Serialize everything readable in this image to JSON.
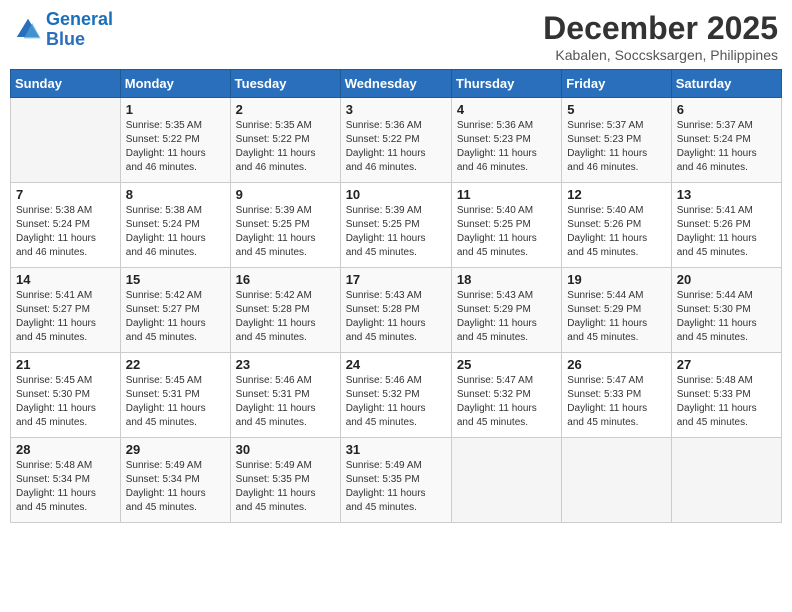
{
  "logo": {
    "line1": "General",
    "line2": "Blue"
  },
  "title": "December 2025",
  "subtitle": "Kabalen, Soccsksargen, Philippines",
  "weekdays": [
    "Sunday",
    "Monday",
    "Tuesday",
    "Wednesday",
    "Thursday",
    "Friday",
    "Saturday"
  ],
  "weeks": [
    [
      {
        "day": "",
        "info": ""
      },
      {
        "day": "1",
        "info": "Sunrise: 5:35 AM\nSunset: 5:22 PM\nDaylight: 11 hours\nand 46 minutes."
      },
      {
        "day": "2",
        "info": "Sunrise: 5:35 AM\nSunset: 5:22 PM\nDaylight: 11 hours\nand 46 minutes."
      },
      {
        "day": "3",
        "info": "Sunrise: 5:36 AM\nSunset: 5:22 PM\nDaylight: 11 hours\nand 46 minutes."
      },
      {
        "day": "4",
        "info": "Sunrise: 5:36 AM\nSunset: 5:23 PM\nDaylight: 11 hours\nand 46 minutes."
      },
      {
        "day": "5",
        "info": "Sunrise: 5:37 AM\nSunset: 5:23 PM\nDaylight: 11 hours\nand 46 minutes."
      },
      {
        "day": "6",
        "info": "Sunrise: 5:37 AM\nSunset: 5:24 PM\nDaylight: 11 hours\nand 46 minutes."
      }
    ],
    [
      {
        "day": "7",
        "info": "Sunrise: 5:38 AM\nSunset: 5:24 PM\nDaylight: 11 hours\nand 46 minutes."
      },
      {
        "day": "8",
        "info": "Sunrise: 5:38 AM\nSunset: 5:24 PM\nDaylight: 11 hours\nand 46 minutes."
      },
      {
        "day": "9",
        "info": "Sunrise: 5:39 AM\nSunset: 5:25 PM\nDaylight: 11 hours\nand 45 minutes."
      },
      {
        "day": "10",
        "info": "Sunrise: 5:39 AM\nSunset: 5:25 PM\nDaylight: 11 hours\nand 45 minutes."
      },
      {
        "day": "11",
        "info": "Sunrise: 5:40 AM\nSunset: 5:25 PM\nDaylight: 11 hours\nand 45 minutes."
      },
      {
        "day": "12",
        "info": "Sunrise: 5:40 AM\nSunset: 5:26 PM\nDaylight: 11 hours\nand 45 minutes."
      },
      {
        "day": "13",
        "info": "Sunrise: 5:41 AM\nSunset: 5:26 PM\nDaylight: 11 hours\nand 45 minutes."
      }
    ],
    [
      {
        "day": "14",
        "info": "Sunrise: 5:41 AM\nSunset: 5:27 PM\nDaylight: 11 hours\nand 45 minutes."
      },
      {
        "day": "15",
        "info": "Sunrise: 5:42 AM\nSunset: 5:27 PM\nDaylight: 11 hours\nand 45 minutes."
      },
      {
        "day": "16",
        "info": "Sunrise: 5:42 AM\nSunset: 5:28 PM\nDaylight: 11 hours\nand 45 minutes."
      },
      {
        "day": "17",
        "info": "Sunrise: 5:43 AM\nSunset: 5:28 PM\nDaylight: 11 hours\nand 45 minutes."
      },
      {
        "day": "18",
        "info": "Sunrise: 5:43 AM\nSunset: 5:29 PM\nDaylight: 11 hours\nand 45 minutes."
      },
      {
        "day": "19",
        "info": "Sunrise: 5:44 AM\nSunset: 5:29 PM\nDaylight: 11 hours\nand 45 minutes."
      },
      {
        "day": "20",
        "info": "Sunrise: 5:44 AM\nSunset: 5:30 PM\nDaylight: 11 hours\nand 45 minutes."
      }
    ],
    [
      {
        "day": "21",
        "info": "Sunrise: 5:45 AM\nSunset: 5:30 PM\nDaylight: 11 hours\nand 45 minutes."
      },
      {
        "day": "22",
        "info": "Sunrise: 5:45 AM\nSunset: 5:31 PM\nDaylight: 11 hours\nand 45 minutes."
      },
      {
        "day": "23",
        "info": "Sunrise: 5:46 AM\nSunset: 5:31 PM\nDaylight: 11 hours\nand 45 minutes."
      },
      {
        "day": "24",
        "info": "Sunrise: 5:46 AM\nSunset: 5:32 PM\nDaylight: 11 hours\nand 45 minutes."
      },
      {
        "day": "25",
        "info": "Sunrise: 5:47 AM\nSunset: 5:32 PM\nDaylight: 11 hours\nand 45 minutes."
      },
      {
        "day": "26",
        "info": "Sunrise: 5:47 AM\nSunset: 5:33 PM\nDaylight: 11 hours\nand 45 minutes."
      },
      {
        "day": "27",
        "info": "Sunrise: 5:48 AM\nSunset: 5:33 PM\nDaylight: 11 hours\nand 45 minutes."
      }
    ],
    [
      {
        "day": "28",
        "info": "Sunrise: 5:48 AM\nSunset: 5:34 PM\nDaylight: 11 hours\nand 45 minutes."
      },
      {
        "day": "29",
        "info": "Sunrise: 5:49 AM\nSunset: 5:34 PM\nDaylight: 11 hours\nand 45 minutes."
      },
      {
        "day": "30",
        "info": "Sunrise: 5:49 AM\nSunset: 5:35 PM\nDaylight: 11 hours\nand 45 minutes."
      },
      {
        "day": "31",
        "info": "Sunrise: 5:49 AM\nSunset: 5:35 PM\nDaylight: 11 hours\nand 45 minutes."
      },
      {
        "day": "",
        "info": ""
      },
      {
        "day": "",
        "info": ""
      },
      {
        "day": "",
        "info": ""
      }
    ]
  ]
}
